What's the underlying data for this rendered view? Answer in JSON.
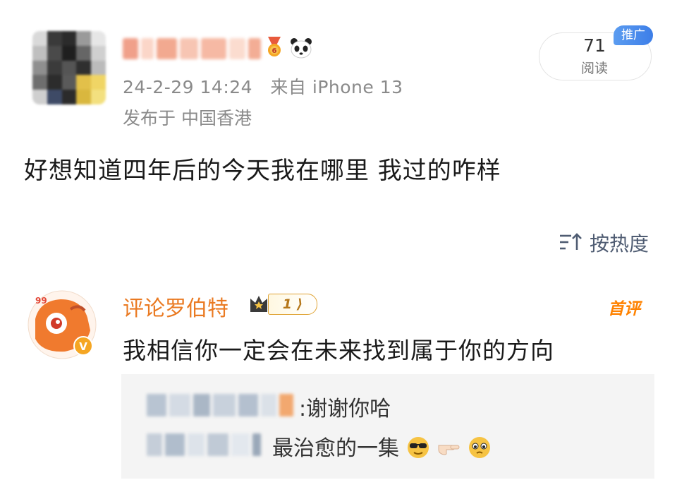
{
  "post": {
    "timestamp": "24-2-29 14:24",
    "source": "来自 iPhone 13",
    "location": "发布于 中国香港",
    "text": "好想知道四年后的今天我在哪里 我过的咋样",
    "read_count": "71",
    "read_label": "阅读",
    "promo_badge": "推广"
  },
  "sort": {
    "label": "按热度",
    "icon": "sort-icon"
  },
  "comment": {
    "author": "评论罗伯特",
    "level": "1",
    "badge": "首评",
    "text": "我相信你一定会在未来找到属于你的方向",
    "replies": [
      {
        "text": ":谢谢你哈"
      },
      {
        "text": "最治愈的一集",
        "emojis": [
          "cool-face-emoji",
          "pointing-hand-emoji",
          "pleading-face-emoji"
        ]
      }
    ]
  },
  "colors": {
    "accent_orange": "#ea7a22",
    "meta_gray": "#8a8a8a",
    "promo_blue": "#3d7ee8",
    "sort_slate": "#4f5c72"
  }
}
